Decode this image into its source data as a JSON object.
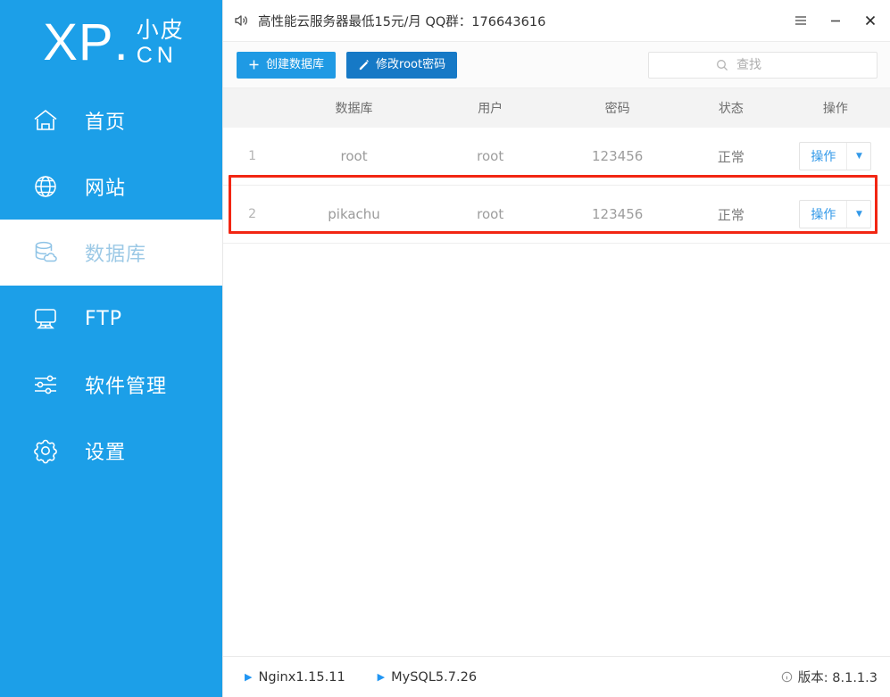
{
  "sidebar": {
    "logo": {
      "main": "XP",
      "dot": ".",
      "cn_top": "小皮",
      "cn_bottom": "CN"
    },
    "items": [
      {
        "label": "首页",
        "icon": "home-icon",
        "active": false
      },
      {
        "label": "网站",
        "icon": "globe-icon",
        "active": false
      },
      {
        "label": "数据库",
        "icon": "database-icon",
        "active": true
      },
      {
        "label": "FTP",
        "icon": "ftp-icon",
        "active": false
      },
      {
        "label": "软件管理",
        "icon": "sliders-icon",
        "active": false
      },
      {
        "label": "设置",
        "icon": "gear-icon",
        "active": false
      }
    ],
    "colors": {
      "background": "#1c9fe8",
      "active_bg": "#ffffff",
      "active_fg": "#9cc9e6"
    }
  },
  "titlebar": {
    "speaker_icon": "speaker-icon",
    "notice": "高性能云服务器最低15元/月  QQ群：176643616",
    "menu_icon": "hamburger-menu-icon",
    "minimize_icon": "minimize-icon",
    "close_icon": "close-icon"
  },
  "toolbar": {
    "create_db_label": "创建数据库",
    "create_db_icon": "plus-icon",
    "change_root_label": "修改root密码",
    "change_root_icon": "pencil-icon",
    "search_placeholder": "查找",
    "search_value": "",
    "search_icon": "search-icon",
    "colors": {
      "create_bg": "#1f9ae4",
      "passwd_bg": "#1679c6"
    }
  },
  "table": {
    "columns": [
      "",
      "数据库",
      "用户",
      "密码",
      "状态",
      "操作"
    ],
    "rows": [
      {
        "index": "1",
        "database": "root",
        "user": "root",
        "password": "123456",
        "status": "正常",
        "action_label": "操作",
        "action_caret": "▼",
        "highlighted": false
      },
      {
        "index": "2",
        "database": "pikachu",
        "user": "root",
        "password": "123456",
        "status": "正常",
        "action_label": "操作",
        "action_caret": "▼",
        "highlighted": true
      }
    ],
    "highlight_color": "#f22613"
  },
  "footer": {
    "services": [
      {
        "name": "Nginx1.15.11",
        "icon": "play-icon"
      },
      {
        "name": "MySQL5.7.26",
        "icon": "play-icon"
      }
    ],
    "version_icon": "info-icon",
    "version_label": "版本: 8.1.1.3"
  }
}
